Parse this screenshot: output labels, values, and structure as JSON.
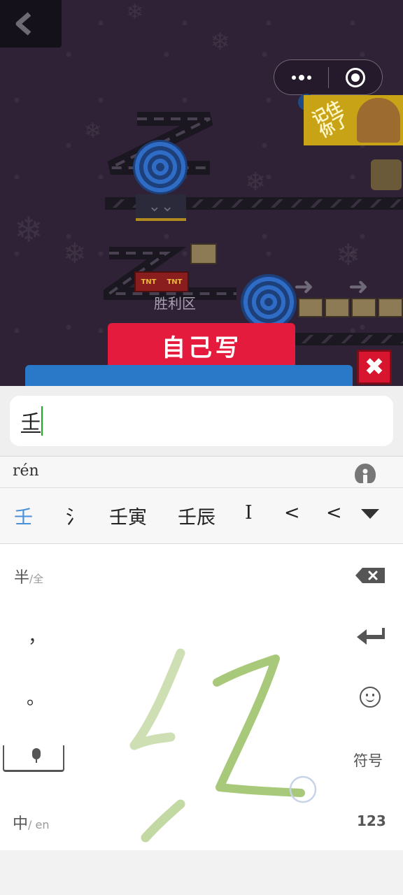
{
  "game": {
    "victory_zone_label": "胜利区",
    "write_yourself_label": "自己写",
    "ad_text": "记住你了",
    "tnt_label": "TNT",
    "close_symbol": "✖",
    "down_symbol": "⌄⌄"
  },
  "navigation": {
    "back_icon": "chevron-left-icon",
    "more_icon": "more-dots-icon",
    "close_miniprogram_icon": "target-circle-icon"
  },
  "input": {
    "value": "壬"
  },
  "ime": {
    "pinyin": "rén",
    "candidates": [
      "壬",
      "氵",
      "壬寅",
      "壬辰",
      "I",
      "<",
      "<"
    ],
    "keys": {
      "half_full": "半",
      "half_full_suffix": "/全",
      "comma": "，",
      "period": "。",
      "cn_en": "中",
      "cn_en_suffix": "/ en",
      "symbols": "符号",
      "numbers": "123"
    }
  }
}
